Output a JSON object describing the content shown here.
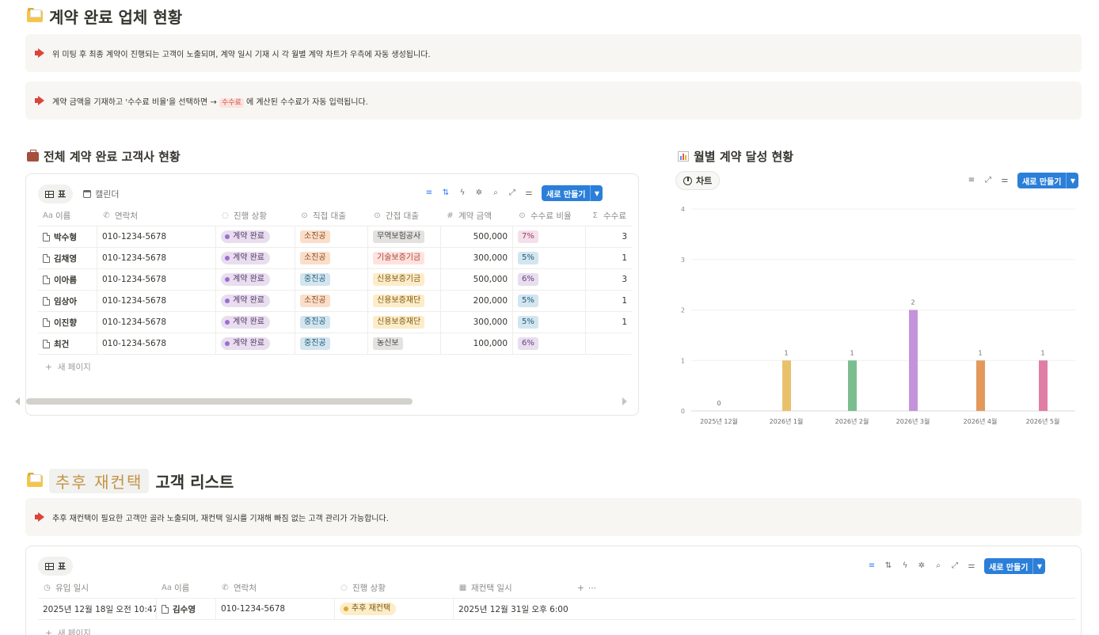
{
  "section1": {
    "title": "계약 완료 업체 현황",
    "callouts": [
      {
        "text": "위 미팅 후 최종 계약이 진행되는 고객이 노출되며, 계약 일시 기재 시 각 월별 계약 차트가 우측에 자동 생성됩니다."
      },
      {
        "text_before": "계약 금액을 기재하고 '수수료 비율'을 선택하면 → ",
        "code": "수수료",
        "text_after": " 에 계산된 수수료가 자동 입력됩니다."
      }
    ]
  },
  "customers_db": {
    "title": "전체 계약 완료 고객사 현황",
    "tabs": [
      {
        "label": "표"
      },
      {
        "label": "캘린더"
      }
    ],
    "new_button": "새로 만들기",
    "columns": [
      "이름",
      "연락처",
      "진행 상황",
      "직접 대출",
      "간접 대출",
      "계약 금액",
      "수수료 비율",
      "수수료"
    ],
    "rows": [
      {
        "name": "박수형",
        "phone": "010-1234-5678",
        "status": "계약 완료",
        "direct": "소진공",
        "indirect": "무역보험공사",
        "amount": "500,000",
        "rate": "7%",
        "fee": "3"
      },
      {
        "name": "김채영",
        "phone": "010-1234-5678",
        "status": "계약 완료",
        "direct": "소진공",
        "indirect": "기술보증기금",
        "amount": "300,000",
        "rate": "5%",
        "fee": "1"
      },
      {
        "name": "이아름",
        "phone": "010-1234-5678",
        "status": "계약 완료",
        "direct": "중진공",
        "indirect": "신용보증기금",
        "amount": "500,000",
        "rate": "6%",
        "fee": "3"
      },
      {
        "name": "임상아",
        "phone": "010-1234-5678",
        "status": "계약 완료",
        "direct": "소진공",
        "indirect": "신용보증재단",
        "amount": "200,000",
        "rate": "5%",
        "fee": "1"
      },
      {
        "name": "이진향",
        "phone": "010-1234-5678",
        "status": "계약 완료",
        "direct": "중진공",
        "indirect": "신용보증재단",
        "amount": "300,000",
        "rate": "5%",
        "fee": "1"
      },
      {
        "name": "최건",
        "phone": "010-1234-5678",
        "status": "계약 완료",
        "direct": "중진공",
        "indirect": "농신보",
        "amount": "100,000",
        "rate": "6%",
        "fee": ""
      }
    ],
    "add_page": "새 페이지",
    "tag_colors": {
      "소진공": "#fadec9",
      "중진공": "#d3e5ef",
      "무역보험공사": "#e3e2e0",
      "기술보증기금": "#ffe2dd",
      "신용보증기금": "#fdecc8",
      "신용보증재단": "#fdecc8",
      "농신보": "#e3e2e0",
      "7%": "#f5e0e9",
      "5%": "#d3e5ef",
      "6%": "#e8deee"
    }
  },
  "chart_section": {
    "title": "월별 계약 달성 현황",
    "tab": "차트",
    "new_button": "새로 만들기"
  },
  "chart_data": {
    "type": "bar",
    "categories": [
      "2025년 12월",
      "2026년 1월",
      "2026년 2월",
      "2026년 3월",
      "2026년 4월",
      "2026년 5월"
    ],
    "values": [
      0,
      1,
      1,
      2,
      1,
      1
    ],
    "colors": [
      "#d9d9d9",
      "#e8c16a",
      "#7bbd8f",
      "#c493dc",
      "#e3995c",
      "#e07ea6"
    ],
    "ylim": [
      0,
      4
    ],
    "yticks": [
      0,
      1,
      2,
      3,
      4
    ],
    "data_labels": true,
    "grid": true
  },
  "section2": {
    "title_tag": "추후 재컨택",
    "title_rest": "고객 리스트",
    "callout": "추후 재컨택이 필요한 고객만 골라 노출되며, 재컨택 일시를 기재해 빠짐 없는 고객 관리가 가능합니다."
  },
  "recontact_db": {
    "tab": "표",
    "new_button": "새로 만들기",
    "columns": [
      "유입 일시",
      "이름",
      "연락처",
      "진행 상황",
      "재컨택 일시"
    ],
    "rows": [
      {
        "date": "2025년 12월 18일 오전 10:47",
        "name": "김수영",
        "phone": "010-1234-5678",
        "status": "추후 재컨택",
        "recontact": "2025년 12월 31일 오후 6:00"
      }
    ],
    "add_page": "새 페이지"
  }
}
